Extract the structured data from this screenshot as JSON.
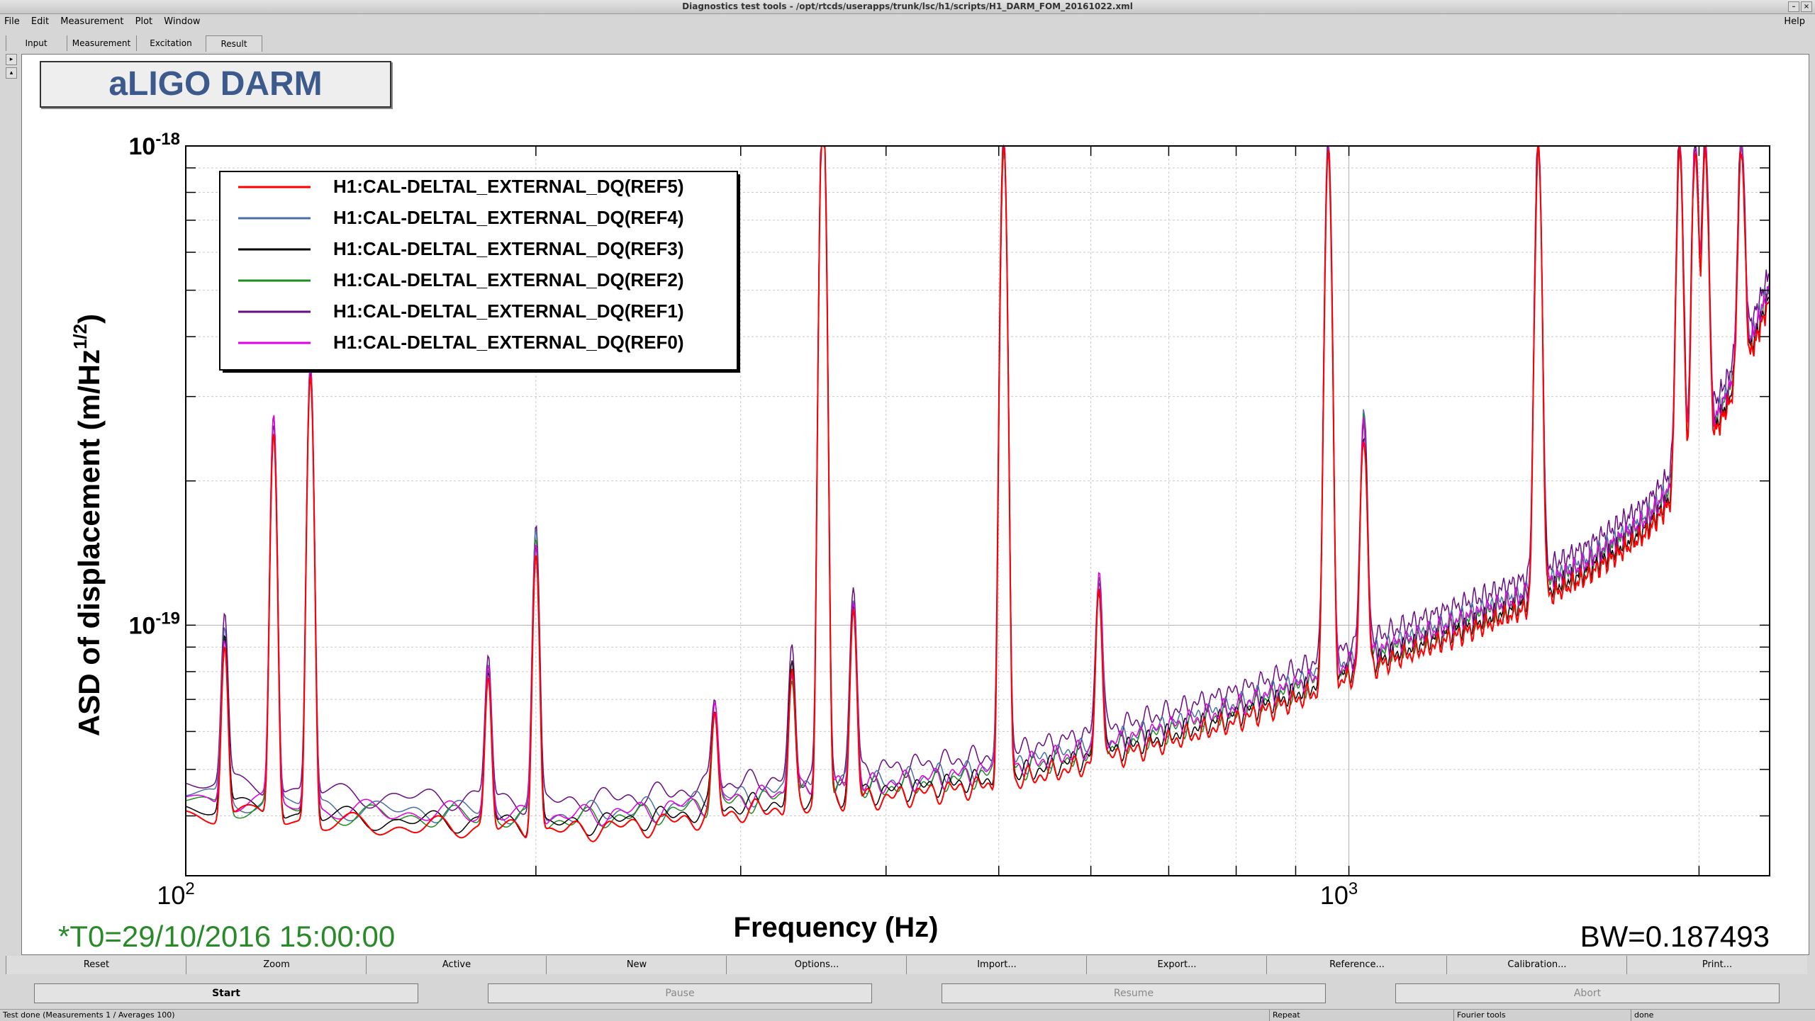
{
  "window": {
    "title": "Diagnostics test tools - /opt/rtcds/userapps/trunk/lsc/h1/scripts/H1_DARM_FOM_20161022.xml"
  },
  "menu": {
    "items": [
      "File",
      "Edit",
      "Measurement",
      "Plot",
      "Window"
    ],
    "help": "Help"
  },
  "tabs": [
    "Input",
    "Measurement",
    "Excitation",
    "Result"
  ],
  "plot_title": "aLIGO DARM",
  "chart_data": {
    "type": "line",
    "title": "aLIGO DARM",
    "xlabel": "Frequency (Hz)",
    "ylabel_main": "ASD of displacement (m/Hz",
    "ylabel_sup": "1/2",
    "ylabel_end": ")",
    "xscale": "log",
    "yscale": "log",
    "xlim": [
      100,
      2300
    ],
    "ylim": [
      3e-20,
      1e-18
    ],
    "x_ticks": [
      {
        "base": "10",
        "exp": "2",
        "value": 100
      },
      {
        "base": "10",
        "exp": "3",
        "value": 1000
      }
    ],
    "y_ticks": [
      {
        "base": "10",
        "exp": "-18",
        "value": 1e-18
      },
      {
        "base": "10",
        "exp": "-19",
        "value": 1e-19
      }
    ],
    "grid": true,
    "legend_position": "top-left",
    "timestamp": "*T0=29/10/2016 15:00:00",
    "bandwidth": "BW=0.187493",
    "series": [
      {
        "name": "H1:CAL-DELTAL_EXTERNAL_DQ(REF5)",
        "color": "#ff0000",
        "scale": 0.97
      },
      {
        "name": "H1:CAL-DELTAL_EXTERNAL_DQ(REF4)",
        "color": "#4a6fa5",
        "scale": 1.05
      },
      {
        "name": "H1:CAL-DELTAL_EXTERNAL_DQ(REF3)",
        "color": "#000000",
        "scale": 1.0
      },
      {
        "name": "H1:CAL-DELTAL_EXTERNAL_DQ(REF2)",
        "color": "#228b22",
        "scale": 1.02
      },
      {
        "name": "H1:CAL-DELTAL_EXTERNAL_DQ(REF1)",
        "color": "#6a0d83",
        "scale": 1.12
      },
      {
        "name": "H1:CAL-DELTAL_EXTERNAL_DQ(REF0)",
        "color": "#e000e0",
        "scale": 1.04
      }
    ],
    "baseline": [
      [
        100,
        4.2e-20
      ],
      [
        115,
        4.1e-20
      ],
      [
        130,
        4e-20
      ],
      [
        150,
        3.9e-20
      ],
      [
        180,
        3.9e-20
      ],
      [
        200,
        3.8e-20
      ],
      [
        250,
        3.95e-20
      ],
      [
        300,
        4.2e-20
      ],
      [
        400,
        4.5e-20
      ],
      [
        500,
        4.8e-20
      ],
      [
        600,
        5.3e-20
      ],
      [
        700,
        5.9e-20
      ],
      [
        800,
        6.5e-20
      ],
      [
        900,
        7.2e-20
      ],
      [
        1000,
        8e-20
      ],
      [
        1100,
        8.8e-20
      ],
      [
        1200,
        9.5e-20
      ],
      [
        1400,
        1.1e-19
      ],
      [
        1600,
        1.3e-19
      ],
      [
        1800,
        1.6e-19
      ],
      [
        2000,
        2.2e-19
      ],
      [
        2200,
        3.6e-19
      ],
      [
        2300,
        4.9e-19
      ]
    ],
    "peaks": [
      {
        "f": 108,
        "amp": 9.5e-20
      },
      {
        "f": 119,
        "amp": 2.6e-19
      },
      {
        "f": 128,
        "amp": 3.4e-19
      },
      {
        "f": 182,
        "amp": 8e-20
      },
      {
        "f": 200,
        "amp": 1.5e-19
      },
      {
        "f": 285,
        "amp": 6.5e-20
      },
      {
        "f": 332,
        "amp": 8e-20
      },
      {
        "f": 353,
        "amp": 1.3e-18
      },
      {
        "f": 375,
        "amp": 1.1e-19
      },
      {
        "f": 505,
        "amp": 1e-18
      },
      {
        "f": 610,
        "amp": 1.2e-19
      },
      {
        "f": 960,
        "amp": 1e-18
      },
      {
        "f": 1030,
        "amp": 2.6e-19
      },
      {
        "f": 1455,
        "amp": 1e-18
      },
      {
        "f": 1925,
        "amp": 1e-18
      },
      {
        "f": 1985,
        "amp": 1e-18
      },
      {
        "f": 2025,
        "amp": 1e-18
      },
      {
        "f": 2175,
        "amp": 1e-18
      }
    ]
  },
  "toolbar": [
    "Reset",
    "Zoom",
    "Active",
    "New",
    "Options...",
    "Import...",
    "Export...",
    "Reference...",
    "Calibration...",
    "Print..."
  ],
  "controls": {
    "start": "Start",
    "pause": "Pause",
    "resume": "Resume",
    "abort": "Abort"
  },
  "status": {
    "main": "Test done (Measurements 1 / Averages 100)",
    "repeat": "Repeat",
    "mode": "Fourier tools",
    "state": "done"
  }
}
